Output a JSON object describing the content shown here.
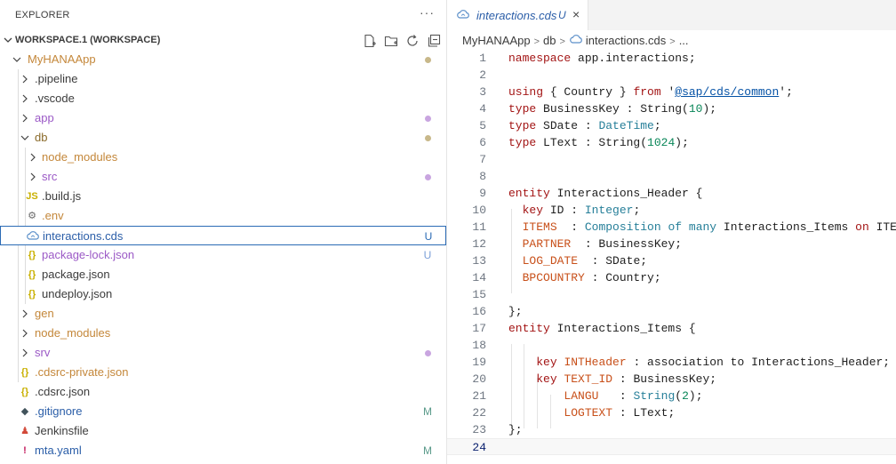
{
  "explorer": {
    "title": "EXPLORER",
    "more": "···",
    "workspace_label": "WORKSPACE.1 (WORKSPACE)",
    "actions": [
      "new-file-icon",
      "new-folder-icon",
      "refresh-icon",
      "collapse-all-icon"
    ],
    "items": [
      {
        "label": "MyHANAApp",
        "type": "folder",
        "expanded": true,
        "depth": 1,
        "color": "#c4873a",
        "deco": "dot",
        "deco_color": "#c8b88a"
      },
      {
        "label": ".pipeline",
        "type": "folder",
        "expanded": false,
        "depth": 2,
        "color": "#3b3b3b"
      },
      {
        "label": ".vscode",
        "type": "folder",
        "expanded": false,
        "depth": 2,
        "color": "#3b3b3b"
      },
      {
        "label": "app",
        "type": "folder",
        "expanded": false,
        "depth": 2,
        "color": "#9b59c6",
        "deco": "dot",
        "deco_color": "#c9a5e0"
      },
      {
        "label": "db",
        "type": "folder",
        "expanded": true,
        "depth": 2,
        "color": "#8a6a2a",
        "deco": "dot",
        "deco_color": "#c8b88a"
      },
      {
        "label": "node_modules",
        "type": "folder",
        "expanded": false,
        "depth": 3,
        "color": "#c4873a"
      },
      {
        "label": "src",
        "type": "folder",
        "expanded": false,
        "depth": 3,
        "color": "#9b59c6",
        "deco": "dot",
        "deco_color": "#c9a5e0"
      },
      {
        "label": ".build.js",
        "type": "file",
        "icon": "js-icon",
        "icon_text": "JS",
        "icon_color": "#c9b000",
        "depth": 3,
        "color": "#3b3b3b"
      },
      {
        "label": ".env",
        "type": "file",
        "icon": "gear-icon",
        "icon_text": "⚙",
        "icon_color": "#6b6b6b",
        "depth": 3,
        "color": "#c4873a"
      },
      {
        "label": "interactions.cds",
        "type": "file",
        "icon": "cds-icon",
        "icon_text": "",
        "icon_color": "#5b8fc9",
        "depth": 3,
        "color": "#2b5ea8",
        "deco": "U",
        "deco_color": "#2b6bb5",
        "selected": true
      },
      {
        "label": "package-lock.json",
        "type": "file",
        "icon": "json-icon",
        "icon_text": "{}",
        "icon_color": "#c9b000",
        "depth": 3,
        "color": "#9b59c6",
        "deco": "U",
        "deco_color": "#7b9fd8"
      },
      {
        "label": "package.json",
        "type": "file",
        "icon": "json-icon",
        "icon_text": "{}",
        "icon_color": "#c9b000",
        "depth": 3,
        "color": "#3b3b3b"
      },
      {
        "label": "undeploy.json",
        "type": "file",
        "icon": "json-icon",
        "icon_text": "{}",
        "icon_color": "#c9b000",
        "depth": 3,
        "color": "#3b3b3b"
      },
      {
        "label": "gen",
        "type": "folder",
        "expanded": false,
        "depth": 2,
        "color": "#c4873a"
      },
      {
        "label": "node_modules",
        "type": "folder",
        "expanded": false,
        "depth": 2,
        "color": "#c4873a"
      },
      {
        "label": "srv",
        "type": "folder",
        "expanded": false,
        "depth": 2,
        "color": "#9b59c6",
        "deco": "dot",
        "deco_color": "#c9a5e0"
      },
      {
        "label": ".cdsrc-private.json",
        "type": "file",
        "icon": "json-icon",
        "icon_text": "{}",
        "icon_color": "#c9b000",
        "depth": 2,
        "color": "#c4873a"
      },
      {
        "label": ".cdsrc.json",
        "type": "file",
        "icon": "json-icon",
        "icon_text": "{}",
        "icon_color": "#c9b000",
        "depth": 2,
        "color": "#3b3b3b"
      },
      {
        "label": ".gitignore",
        "type": "file",
        "icon": "git-icon",
        "icon_text": "◆",
        "icon_color": "#41535b",
        "depth": 2,
        "color": "#2b5ea8",
        "deco": "M",
        "deco_color": "#5a9a8a"
      },
      {
        "label": "Jenkinsfile",
        "type": "file",
        "icon": "jenkins-icon",
        "icon_text": "♟",
        "icon_color": "#d24939",
        "depth": 2,
        "color": "#3b3b3b"
      },
      {
        "label": "mta.yaml",
        "type": "file",
        "icon": "yaml-icon",
        "icon_text": "!",
        "icon_color": "#c2185b",
        "depth": 2,
        "color": "#2b5ea8",
        "deco": "M",
        "deco_color": "#5a9a8a"
      }
    ]
  },
  "editor": {
    "tab": {
      "label": "interactions.cds",
      "status": "U",
      "close": "×"
    },
    "breadcrumb": [
      "MyHANAApp",
      "db",
      "interactions.cds",
      "..."
    ],
    "current_line": 24,
    "lines": [
      {
        "n": "1",
        "tokens": [
          [
            "namespace",
            "kw"
          ],
          [
            " app.interactions;",
            "plain"
          ]
        ]
      },
      {
        "n": "2",
        "tokens": []
      },
      {
        "n": "3",
        "tokens": [
          [
            "using",
            "kw"
          ],
          [
            " { Country } ",
            "plain"
          ],
          [
            "from",
            "kw"
          ],
          [
            " '",
            "plain"
          ],
          [
            "@sap/cds/common",
            "str-u"
          ],
          [
            "';",
            "plain"
          ]
        ]
      },
      {
        "n": "4",
        "tokens": [
          [
            "type",
            "kw"
          ],
          [
            " BusinessKey : String(",
            "plain"
          ],
          [
            "10",
            "num"
          ],
          [
            ");",
            "plain"
          ]
        ]
      },
      {
        "n": "5",
        "tokens": [
          [
            "type",
            "kw"
          ],
          [
            " SDate : ",
            "plain"
          ],
          [
            "DateTime",
            "type"
          ],
          [
            ";",
            "plain"
          ]
        ]
      },
      {
        "n": "6",
        "tokens": [
          [
            "type",
            "kw"
          ],
          [
            " LText : String(",
            "plain"
          ],
          [
            "1024",
            "num"
          ],
          [
            ");",
            "plain"
          ]
        ]
      },
      {
        "n": "7",
        "tokens": []
      },
      {
        "n": "8",
        "tokens": []
      },
      {
        "n": "9",
        "tokens": [
          [
            "entity",
            "kw"
          ],
          [
            " Interactions_Header {",
            "plain"
          ]
        ]
      },
      {
        "n": "10",
        "tokens": [
          [
            "  ",
            "plain"
          ],
          [
            "key",
            "kw"
          ],
          [
            " ID : ",
            "plain"
          ],
          [
            "Integer",
            "type"
          ],
          [
            ";",
            "plain"
          ]
        ]
      },
      {
        "n": "11",
        "tokens": [
          [
            "  ",
            "plain"
          ],
          [
            "ITEMS",
            "field"
          ],
          [
            "  : ",
            "plain"
          ],
          [
            "Composition",
            "type"
          ],
          [
            " ",
            "plain"
          ],
          [
            "of",
            "type"
          ],
          [
            " ",
            "plain"
          ],
          [
            "many",
            "type"
          ],
          [
            " Interactions_Items ",
            "plain"
          ],
          [
            "on",
            "kw"
          ],
          [
            " ITEM",
            "plain"
          ]
        ]
      },
      {
        "n": "12",
        "tokens": [
          [
            "  ",
            "plain"
          ],
          [
            "PARTNER",
            "field"
          ],
          [
            "  : BusinessKey;",
            "plain"
          ]
        ]
      },
      {
        "n": "13",
        "tokens": [
          [
            "  ",
            "plain"
          ],
          [
            "LOG_DATE",
            "field"
          ],
          [
            "  : SDate;",
            "plain"
          ]
        ]
      },
      {
        "n": "14",
        "tokens": [
          [
            "  ",
            "plain"
          ],
          [
            "BPCOUNTRY",
            "field"
          ],
          [
            " : Country;",
            "plain"
          ]
        ]
      },
      {
        "n": "15",
        "tokens": []
      },
      {
        "n": "16",
        "tokens": [
          [
            "};",
            "plain"
          ]
        ]
      },
      {
        "n": "17",
        "tokens": [
          [
            "entity",
            "kw"
          ],
          [
            " Interactions_Items {",
            "plain"
          ]
        ]
      },
      {
        "n": "18",
        "tokens": []
      },
      {
        "n": "19",
        "tokens": [
          [
            "    ",
            "plain"
          ],
          [
            "key",
            "kw"
          ],
          [
            " ",
            "plain"
          ],
          [
            "INTHeader",
            "field"
          ],
          [
            " : association to Interactions_Header;",
            "plain"
          ]
        ]
      },
      {
        "n": "20",
        "tokens": [
          [
            "    ",
            "plain"
          ],
          [
            "key",
            "kw"
          ],
          [
            " ",
            "plain"
          ],
          [
            "TEXT_ID",
            "field"
          ],
          [
            " : BusinessKey;",
            "plain"
          ]
        ]
      },
      {
        "n": "21",
        "tokens": [
          [
            "        ",
            "plain"
          ],
          [
            "LANGU",
            "field"
          ],
          [
            "   : ",
            "plain"
          ],
          [
            "String",
            "type"
          ],
          [
            "(",
            "plain"
          ],
          [
            "2",
            "num"
          ],
          [
            ");",
            "plain"
          ]
        ]
      },
      {
        "n": "22",
        "tokens": [
          [
            "        ",
            "plain"
          ],
          [
            "LOGTEXT",
            "field"
          ],
          [
            " : LText;",
            "plain"
          ]
        ]
      },
      {
        "n": "23",
        "tokens": [
          [
            "};",
            "plain"
          ]
        ]
      },
      {
        "n": "24",
        "tokens": []
      }
    ]
  }
}
